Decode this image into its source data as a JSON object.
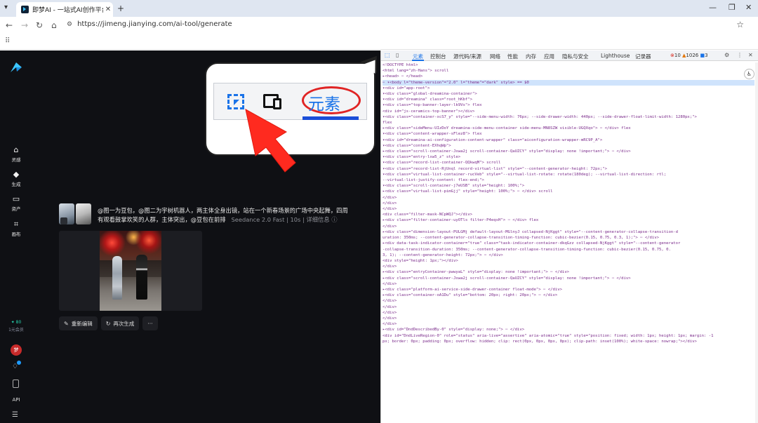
{
  "browser": {
    "tab_title": "即梦AI - 一站式AI创作平台",
    "url": "https://jimeng.jianying.com/ai-tool/generate"
  },
  "app": {
    "nav": [
      {
        "icon": "home-icon",
        "label": "灵感"
      },
      {
        "icon": "sparkle-icon",
        "label": "生成"
      },
      {
        "icon": "folder-icon",
        "label": "资产"
      },
      {
        "icon": "canvas-icon",
        "label": "画布"
      }
    ],
    "credits_value": "✦ 80",
    "credits_label": "1元会员",
    "avatar_text": "梦",
    "api_label": "API",
    "record": {
      "prompt": "@图一为豆包，@图二为宇树机器人，两主体全身出镜，站在一个新春场景的广场中央起舞，四周有观看鼓掌欢笑的人群，主体突出，@豆包在前排",
      "model": "Seedance 2.0 Fast",
      "duration": "10s",
      "details": "详细信息"
    },
    "actions": {
      "reedit": "重新编辑",
      "regenerate": "再次生成",
      "more": "···"
    }
  },
  "devtools": {
    "tabs": [
      "元素",
      "控制台",
      "源代码/来源",
      "网络",
      "性能",
      "内存",
      "应用",
      "隐私与安全",
      "Lighthouse",
      "记录器"
    ],
    "errors": "10",
    "warnings": "1026",
    "info": "3",
    "callout_label": "元素",
    "code_lines": [
      "<!DOCTYPE html>",
      "<html lang=\"zh-Hans\"> scroll",
      "▸<head> ⋯ </head>",
      "⋯ ▾<body l=\"theme-version\"=\"2.0\" l=\"theme\"=\"dark\" style> == $0",
      "  ▾<div id=\"app-root\">",
      "    ▾<div class=\"global-dreamina-container\">",
      "      ▾<div id=\"dreamina\" class=\"root_hKbf\">",
      "        ▾<div class=\"top-banner-layer-lk9Vs\"> flex",
      "          <div id=\"js-ceramics-top-banner\"></div>",
      "        ▾<div class=\"container-xcS7_y\" style=\"--side-menu-width: 76px; --side-drawer-width: 440px; --side-drawer-float-limit-width: 1280px;\">",
      "            flex",
      "          ▸<div class=\"sideMenu-UIzDoY dreamina-side-menu-container side-menu-MN8SZW visible-UGQXqo\"> ⋯ </div> flex",
      "          ▾<div class=\"content-wrapper-sFlez8\"> flex",
      "            ▾<div id=\"dreamina-ai-configuration-content-wrapper\" class=\"aiconfiguration-wrapper-mRC9P_A\">",
      "              ▾<div class=\"content-EXhqWp\">",
      "                ▸<div class=\"scroll-container-Jxwa2j scroll-container-QaUZCY\" style=\"display: none !important;\"> ⋯ </div>",
      "                ▾<div class=\"entry-lxw5_z\" style>",
      "                  ▾<div class=\"record-list-container-QQkwqM\"> scroll",
      "                    ▾<div class=\"record-list-RjUnql record-virtual-list\" style=\"--content-generator-height: 72px;\">",
      "                      ▾<div class=\"virtual-list-container-rucVeb\" style=\"--virtual-list-rotate: rotate(180deg); --virtual-list-direction: rtl;",
      "                        --virtual-list-justify-content: flex-end;\">",
      "                        ▾<div class=\"scroll-container-j7eUSB\" style=\"height: 100%;\">",
      "                          ▸<div class=\"virtual-list-pimGjj\" style=\"height: 100%;\"> ⋯ </div> scroll",
      "                          </div>",
      "                        </div>",
      "                      </div>",
      "                      <div class=\"filter-mask-NCpWQJ\"></div>",
      "                      ▸<div class=\"filter-container-uyOTls filter-P4eqsH\"> ⋯ </div> flex",
      "                    </div>",
      "                    ▸<div class=\"dimension-layout-PULGMj default-layout-MGlnyJ collapsed-NjKggt\" style=\"--content-generator-collapse-transition-d",
      "                      uration: 350ms; --content-generator-collapse-transition-timing-function: cubic-bezier(0.15, 0.75, 0.3, 1);\"> ⋯ </div>",
      "                    ▸<div data-task-indicator-container=\"true\" class=\"task-indicator-container-dkqGzz collapsed-NjKggt\" style=\"--content-generator",
      "                      -collapse-transition-duration: 350ms; --content-generator-collapse-transition-timing-function: cubic-bezier(0.15, 0.75, 0.",
      "                      3, 1); --content-generator-height: 72px;\"> ⋯ </div>",
      "                    <div style=\"height: 1px;\"></div>",
      "                  </div>",
      "                ▸<div class=\"entryContainer-pwwyaL\" style=\"display: none !important;\"> ⋯ </div>",
      "                ▸<div class=\"scroll-container-Jxwa2j scroll-container-QaUZCY\" style=\"display: none !important;\"> ⋯ </div>",
      "              </div>",
      "            ▸<div class=\"platform-ai-service-side-drawer-container float-mode\"> ⋯ </div>",
      "            ▸<div class=\"container-oA1Du\" style=\"bottom: 20px; right: 20px;\"> ⋯ </div>",
      "          </div>",
      "        </div>",
      "      </div>",
      "    </div>",
      "  </div>",
      "  ▸<div id=\"DndDescribedBy-0\" style=\"display: none;\"> ⋯ </div>",
      "    <div id=\"DndLiveRegion-0\" role=\"status\" aria-live=\"assertive\" aria-atomic=\"true\" style=\"position: fixed; width: 1px; height: 1px; margin: -1",
      "    px; border: 0px; padding: 0px; overflow: hidden; clip: rect(0px, 0px, 0px, 0px); clip-path: inset(100%); white-space: nowrap;\"></div>"
    ]
  },
  "colors": {
    "accent": "#1a73e8",
    "app_bg": "#0f1014",
    "annotation_red": "#e02424"
  }
}
